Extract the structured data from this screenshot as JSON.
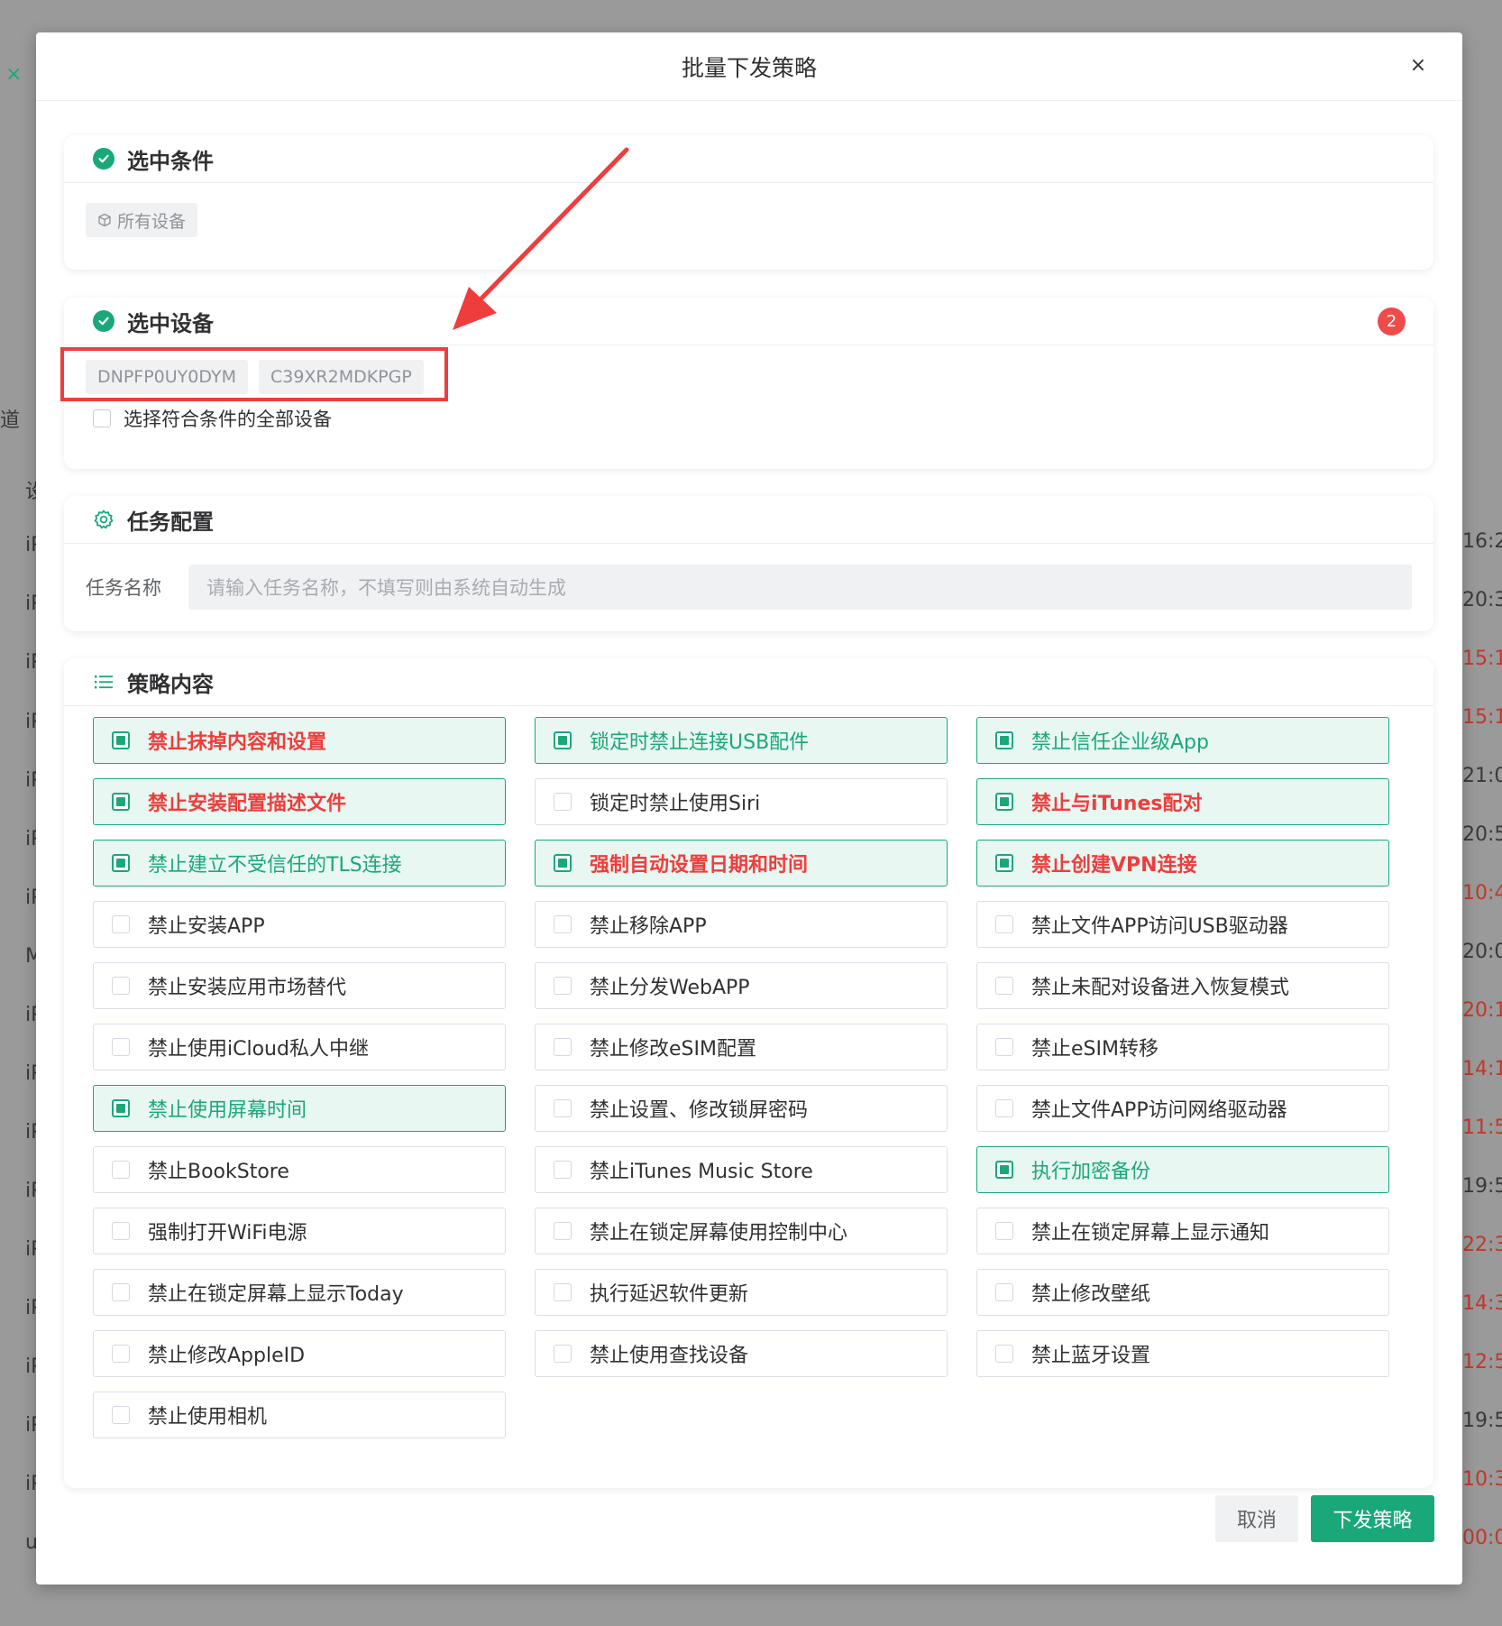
{
  "background": {
    "left_fragments": [
      "×",
      "道",
      "设",
      "iP",
      "iP",
      "iP",
      "iP",
      "iP",
      "iP",
      "iP",
      "M",
      "iP",
      "iP",
      "iP",
      "iP",
      "iP",
      "iP",
      "iP",
      "iP",
      "iP",
      "u"
    ],
    "right_times": [
      {
        "text": "16:2",
        "red": false
      },
      {
        "text": "20:3",
        "red": false
      },
      {
        "text": "15:1",
        "red": true
      },
      {
        "text": "15:1",
        "red": true
      },
      {
        "text": "21:0",
        "red": false
      },
      {
        "text": "20:5",
        "red": false
      },
      {
        "text": "10:4",
        "red": true
      },
      {
        "text": "20:0",
        "red": false
      },
      {
        "text": "20:1",
        "red": true
      },
      {
        "text": "14:1",
        "red": true
      },
      {
        "text": "11:5",
        "red": true
      },
      {
        "text": "19:5",
        "red": false
      },
      {
        "text": "22:3",
        "red": true
      },
      {
        "text": "14:3",
        "red": true
      },
      {
        "text": "12:5",
        "red": true
      },
      {
        "text": "19:5",
        "red": false
      },
      {
        "text": "10:3",
        "red": true
      },
      {
        "text": "00:0",
        "red": true
      }
    ]
  },
  "modal": {
    "title": "批量下发策略",
    "close_icon": "×"
  },
  "conditions": {
    "title": "选中条件",
    "tag_label": "所有设备"
  },
  "devices": {
    "title": "选中设备",
    "count": "2",
    "tags": [
      "DNPFP0UY0DYM",
      "C39XR2MDKPGP"
    ],
    "select_all_label": "选择符合条件的全部设备"
  },
  "task": {
    "title": "任务配置",
    "name_label": "任务名称",
    "name_placeholder": "请输入任务名称，不填写则由系统自动生成"
  },
  "policies": {
    "title": "策略内容",
    "items": [
      {
        "label": "禁止抹掉内容和设置",
        "checked": true,
        "danger": true
      },
      {
        "label": "锁定时禁止连接USB配件",
        "checked": true,
        "danger": false
      },
      {
        "label": "禁止信任企业级App",
        "checked": true,
        "danger": false
      },
      {
        "label": "禁止安装配置描述文件",
        "checked": true,
        "danger": true
      },
      {
        "label": "锁定时禁止使用Siri",
        "checked": false,
        "danger": false
      },
      {
        "label": "禁止与iTunes配对",
        "checked": true,
        "danger": true
      },
      {
        "label": "禁止建立不受信任的TLS连接",
        "checked": true,
        "danger": false
      },
      {
        "label": "强制自动设置日期和时间",
        "checked": true,
        "danger": true
      },
      {
        "label": "禁止创建VPN连接",
        "checked": true,
        "danger": true
      },
      {
        "label": "禁止安装APP",
        "checked": false,
        "danger": false
      },
      {
        "label": "禁止移除APP",
        "checked": false,
        "danger": false
      },
      {
        "label": "禁止文件APP访问USB驱动器",
        "checked": false,
        "danger": false
      },
      {
        "label": "禁止安装应用市场替代",
        "checked": false,
        "danger": false
      },
      {
        "label": "禁止分发WebAPP",
        "checked": false,
        "danger": false
      },
      {
        "label": "禁止未配对设备进入恢复模式",
        "checked": false,
        "danger": false
      },
      {
        "label": "禁止使用iCloud私人中继",
        "checked": false,
        "danger": false
      },
      {
        "label": "禁止修改eSIM配置",
        "checked": false,
        "danger": false
      },
      {
        "label": "禁止eSIM转移",
        "checked": false,
        "danger": false
      },
      {
        "label": "禁止使用屏幕时间",
        "checked": true,
        "danger": false
      },
      {
        "label": "禁止设置、修改锁屏密码",
        "checked": false,
        "danger": false
      },
      {
        "label": "禁止文件APP访问网络驱动器",
        "checked": false,
        "danger": false
      },
      {
        "label": "禁止BookStore",
        "checked": false,
        "danger": false
      },
      {
        "label": "禁止iTunes Music Store",
        "checked": false,
        "danger": false
      },
      {
        "label": "执行加密备份",
        "checked": true,
        "danger": false
      },
      {
        "label": "强制打开WiFi电源",
        "checked": false,
        "danger": false
      },
      {
        "label": "禁止在锁定屏幕使用控制中心",
        "checked": false,
        "danger": false
      },
      {
        "label": "禁止在锁定屏幕上显示通知",
        "checked": false,
        "danger": false
      },
      {
        "label": "禁止在锁定屏幕上显示Today",
        "checked": false,
        "danger": false
      },
      {
        "label": "执行延迟软件更新",
        "checked": false,
        "danger": false
      },
      {
        "label": "禁止修改壁纸",
        "checked": false,
        "danger": false
      },
      {
        "label": "禁止修改AppleID",
        "checked": false,
        "danger": false
      },
      {
        "label": "禁止使用查找设备",
        "checked": false,
        "danger": false
      },
      {
        "label": "禁止蓝牙设置",
        "checked": false,
        "danger": false
      },
      {
        "label": "禁止使用相机",
        "checked": false,
        "danger": false
      }
    ]
  },
  "footer": {
    "cancel_label": "取消",
    "submit_label": "下发策略"
  },
  "colors": {
    "accent": "#1aa87a",
    "danger": "#ef3d3d",
    "annotation": "#ef3d3d"
  },
  "icons": {
    "check_circle": "check-circle-icon",
    "cube": "cube-icon",
    "gear": "gear-icon",
    "list": "list-icon",
    "close": "close-icon"
  }
}
